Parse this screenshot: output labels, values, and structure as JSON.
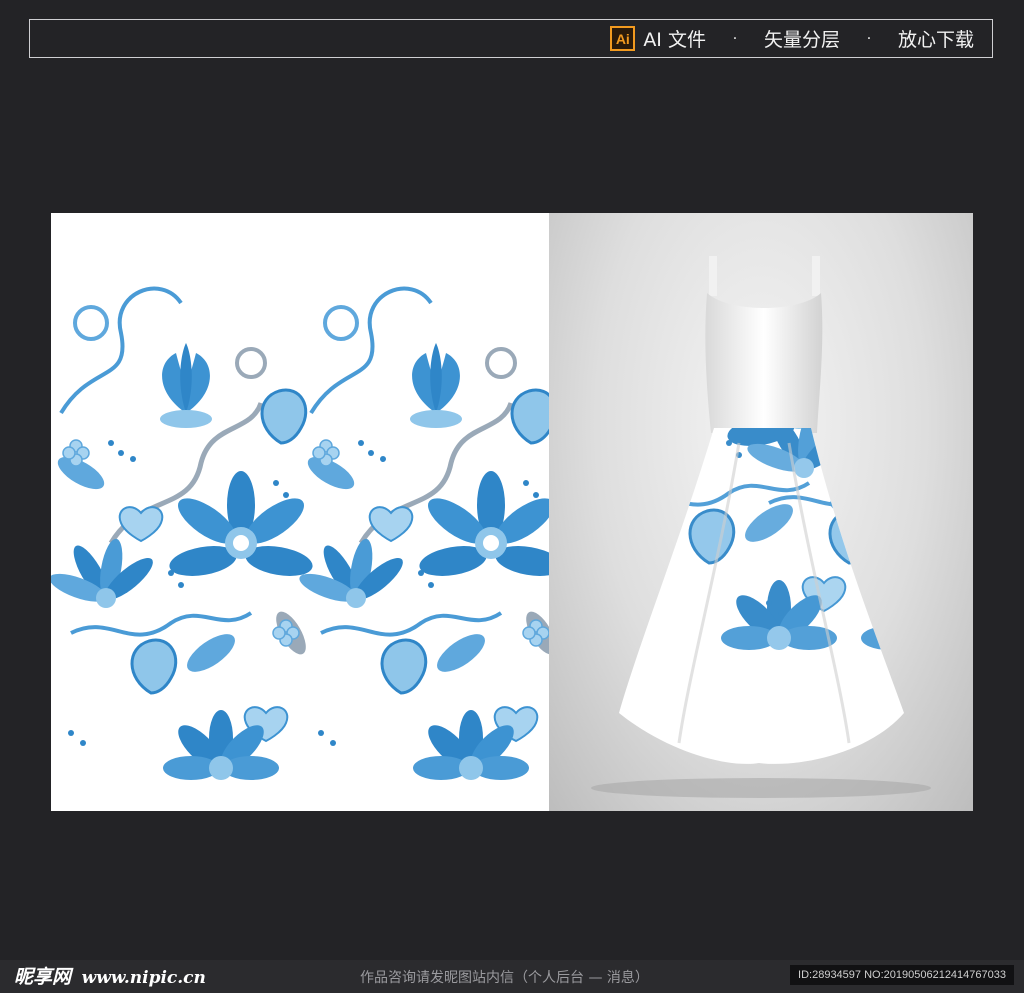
{
  "header": {
    "ai_badge": "Ai",
    "tags": [
      "AI 文件",
      "矢量分层",
      "放心下载"
    ],
    "separator": "·"
  },
  "colors": {
    "background": "#232326",
    "pattern_blue": "#2f86c8",
    "pattern_light": "#8fc6ea",
    "pattern_grey": "#9aa9b8",
    "ai_orange": "#f29a1f"
  },
  "footer": {
    "logo": "昵享网",
    "logo_url": "www.nipic.cn",
    "message": "作品咨询请发昵图站内信（个人后台 — 消息）",
    "id_text": "ID:28934597 NO:20190506212414767033"
  }
}
